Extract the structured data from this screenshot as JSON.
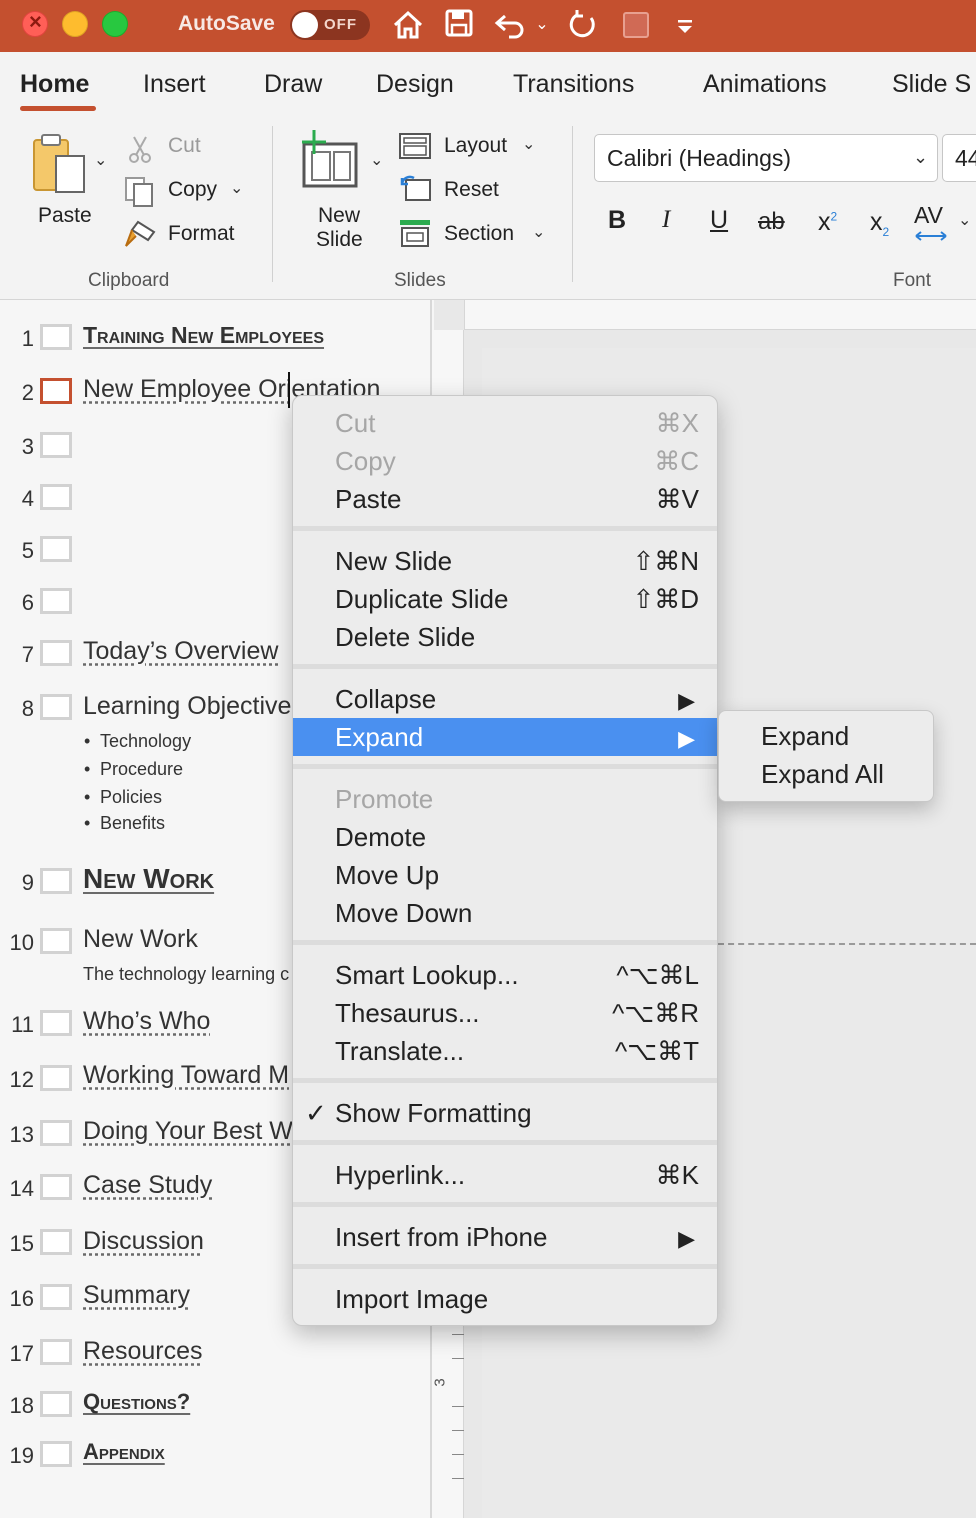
{
  "titlebar": {
    "autosave_label": "AutoSave",
    "autosave_state": "OFF"
  },
  "ribbon_tabs": [
    "Home",
    "Insert",
    "Draw",
    "Design",
    "Transitions",
    "Animations",
    "Slide S"
  ],
  "clipboard": {
    "paste": "Paste",
    "cut": "Cut",
    "copy": "Copy",
    "format": "Format",
    "group_label": "Clipboard"
  },
  "slides_group": {
    "new_slide_line1": "New",
    "new_slide_line2": "Slide",
    "layout": "Layout",
    "reset": "Reset",
    "section": "Section",
    "group_label": "Slides"
  },
  "font_group": {
    "font_name": "Calibri (Headings)",
    "font_size": "44",
    "bold": "B",
    "italic": "I",
    "underline": "U",
    "strike": "ab",
    "superscript": "x",
    "subscript": "x",
    "spacing": "AV",
    "group_label": "Font"
  },
  "outline": {
    "s1": {
      "num": "1",
      "title": "Training New Employees"
    },
    "s2": {
      "num": "2",
      "title": "New Employee Orientation"
    },
    "s3": {
      "num": "3"
    },
    "s4": {
      "num": "4"
    },
    "s5": {
      "num": "5"
    },
    "s6": {
      "num": "6"
    },
    "s7": {
      "num": "7",
      "title": "Today’s Overview"
    },
    "s8": {
      "num": "8",
      "title": "Learning Objective",
      "bullets": [
        "Technology",
        "Procedure",
        "Policies",
        "Benefits"
      ]
    },
    "s9": {
      "num": "9",
      "title": "New Work"
    },
    "s10": {
      "num": "10",
      "title": "New Work",
      "sub": "The technology learning c"
    },
    "s11": {
      "num": "11",
      "title": "Who’s Who"
    },
    "s12": {
      "num": "12",
      "title": "Working Toward M"
    },
    "s13": {
      "num": "13",
      "title": "Doing Your Best W"
    },
    "s14": {
      "num": "14",
      "title": "Case Study"
    },
    "s15": {
      "num": "15",
      "title": "Discussion"
    },
    "s16": {
      "num": "16",
      "title": "Summary"
    },
    "s17": {
      "num": "17",
      "title": "Resources"
    },
    "s18": {
      "num": "18",
      "title": "Questions?"
    },
    "s19": {
      "num": "19",
      "title": "Appendix"
    }
  },
  "ruler": {
    "mark": "3"
  },
  "context_menu": {
    "cut": {
      "label": "Cut",
      "shortcut": "⌘X"
    },
    "copy": {
      "label": "Copy",
      "shortcut": "⌘C"
    },
    "paste": {
      "label": "Paste",
      "shortcut": "⌘V"
    },
    "new_slide": {
      "label": "New Slide",
      "shortcut": "⇧⌘N"
    },
    "duplicate_slide": {
      "label": "Duplicate Slide",
      "shortcut": "⇧⌘D"
    },
    "delete_slide": {
      "label": "Delete Slide"
    },
    "collapse": {
      "label": "Collapse"
    },
    "expand": {
      "label": "Expand"
    },
    "promote": {
      "label": "Promote"
    },
    "demote": {
      "label": "Demote"
    },
    "move_up": {
      "label": "Move Up"
    },
    "move_down": {
      "label": "Move Down"
    },
    "smart_lookup": {
      "label": "Smart Lookup...",
      "shortcut": "^⌥⌘L"
    },
    "thesaurus": {
      "label": "Thesaurus...",
      "shortcut": "^⌥⌘R"
    },
    "translate": {
      "label": "Translate...",
      "shortcut": "^⌥⌘T"
    },
    "show_formatting": {
      "label": "Show Formatting",
      "checked": true
    },
    "hyperlink": {
      "label": "Hyperlink...",
      "shortcut": "⌘K"
    },
    "insert_from_iphone": {
      "label": "Insert from iPhone"
    },
    "import_image": {
      "label": "Import Image"
    }
  },
  "submenu": {
    "expand": "Expand",
    "expand_all": "Expand All"
  },
  "colors": {
    "accent": "#c4502f",
    "highlight": "#4a90f0"
  }
}
